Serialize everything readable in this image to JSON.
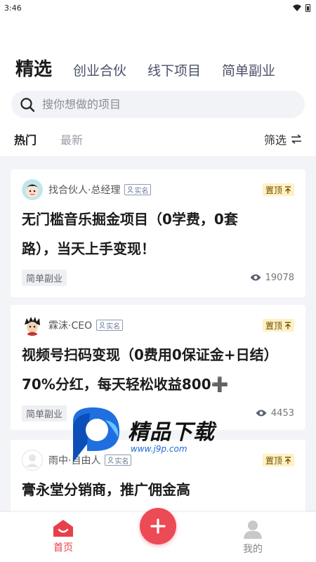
{
  "status": {
    "time": "3:46"
  },
  "tabs": [
    {
      "label": "精选"
    },
    {
      "label": "创业合伙"
    },
    {
      "label": "线下项目"
    },
    {
      "label": "简单副业"
    }
  ],
  "search": {
    "placeholder": "搜你想做的项目"
  },
  "sort": {
    "hot": "热门",
    "latest": "最新",
    "filter": "筛选"
  },
  "cards": [
    {
      "author": "找合伙人·总经理",
      "verify": "实名",
      "pin": "置顶",
      "title_line1": "无门槛音乐掘金项目（0学费，0套",
      "title_line2": "路），当天上手变现！",
      "tag": "简单副业",
      "views": "19078"
    },
    {
      "author": "霖沫·CEO",
      "verify": "实名",
      "pin": "置顶",
      "title_line1": "视频号扫码变现（0费用0保证金+日结）",
      "title_line2": "70%分红，每天轻松收益800➕",
      "tag": "简单副业",
      "views": "4453"
    },
    {
      "author": "雨中·自由人",
      "verify": "实名",
      "pin": "置顶",
      "title_line1": "膏永堂分销商，推广佣金高",
      "title_line2": "",
      "tag": "",
      "views": ""
    }
  ],
  "watermark": {
    "title": "精品下载",
    "url": "www.j9p.com"
  },
  "bottom_nav": {
    "home": "首页",
    "me": "我的"
  }
}
